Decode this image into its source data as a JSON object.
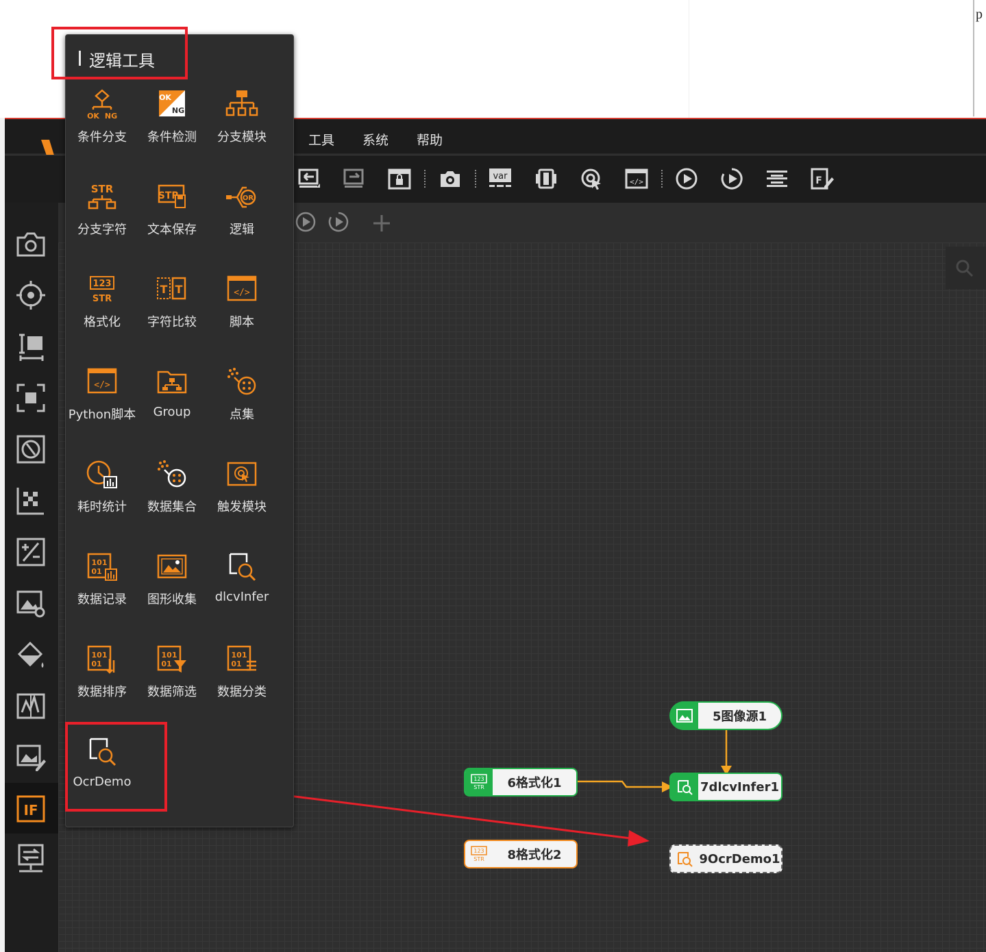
{
  "document": {
    "right_edge_letter": "p"
  },
  "menu": {
    "items": [
      "工具",
      "系统",
      "帮助"
    ]
  },
  "popup": {
    "title": "逻辑工具",
    "tools": [
      {
        "label": "条件分支",
        "icon": "branch-ok-ng-icon"
      },
      {
        "label": "条件检测",
        "icon": "ok-ng-check-icon"
      },
      {
        "label": "分支模块",
        "icon": "branch-module-icon"
      },
      {
        "label": "分支字符",
        "icon": "branch-string-icon"
      },
      {
        "label": "文本保存",
        "icon": "text-save-icon"
      },
      {
        "label": "逻辑",
        "icon": "logic-or-icon"
      },
      {
        "label": "格式化",
        "icon": "format-123-str-icon"
      },
      {
        "label": "字符比较",
        "icon": "string-compare-icon"
      },
      {
        "label": "脚本",
        "icon": "script-icon"
      },
      {
        "label": "Python脚本",
        "icon": "python-script-icon"
      },
      {
        "label": "Group",
        "icon": "group-icon"
      },
      {
        "label": "点集",
        "icon": "point-set-icon"
      },
      {
        "label": "耗时统计",
        "icon": "time-stat-icon"
      },
      {
        "label": "数据集合",
        "icon": "data-set-icon"
      },
      {
        "label": "触发模块",
        "icon": "trigger-icon"
      },
      {
        "label": "数据记录",
        "icon": "data-record-icon"
      },
      {
        "label": "图形收集",
        "icon": "image-collect-icon"
      },
      {
        "label": "dlcvInfer",
        "icon": "dlcv-infer-icon"
      },
      {
        "label": "数据排序",
        "icon": "data-sort-icon"
      },
      {
        "label": "数据筛选",
        "icon": "data-filter-icon"
      },
      {
        "label": "数据分类",
        "icon": "data-classify-icon"
      },
      {
        "label": "OcrDemo",
        "icon": "ocr-demo-icon"
      }
    ]
  },
  "flow": {
    "nodes": [
      {
        "label": "5图像源1",
        "icon": "image-source-icon",
        "accent": "#22b04b"
      },
      {
        "label": "6格式化1",
        "icon": "format-icon",
        "accent": "#22b04b"
      },
      {
        "label": "7dlcvInfer1",
        "icon": "dlcv-infer-icon",
        "accent": "#22b04b"
      },
      {
        "label": "8格式化2",
        "icon": "format-icon",
        "accent": "#f28a1e"
      },
      {
        "label": "9OcrDemo1",
        "icon": "ocr-demo-icon",
        "accent": "#f28a1e"
      }
    ]
  },
  "colors": {
    "icon_orange": "#f28a1e",
    "node_green": "#22b04b",
    "highlight_red": "#e8202a",
    "connector_orange": "#f5a623"
  }
}
